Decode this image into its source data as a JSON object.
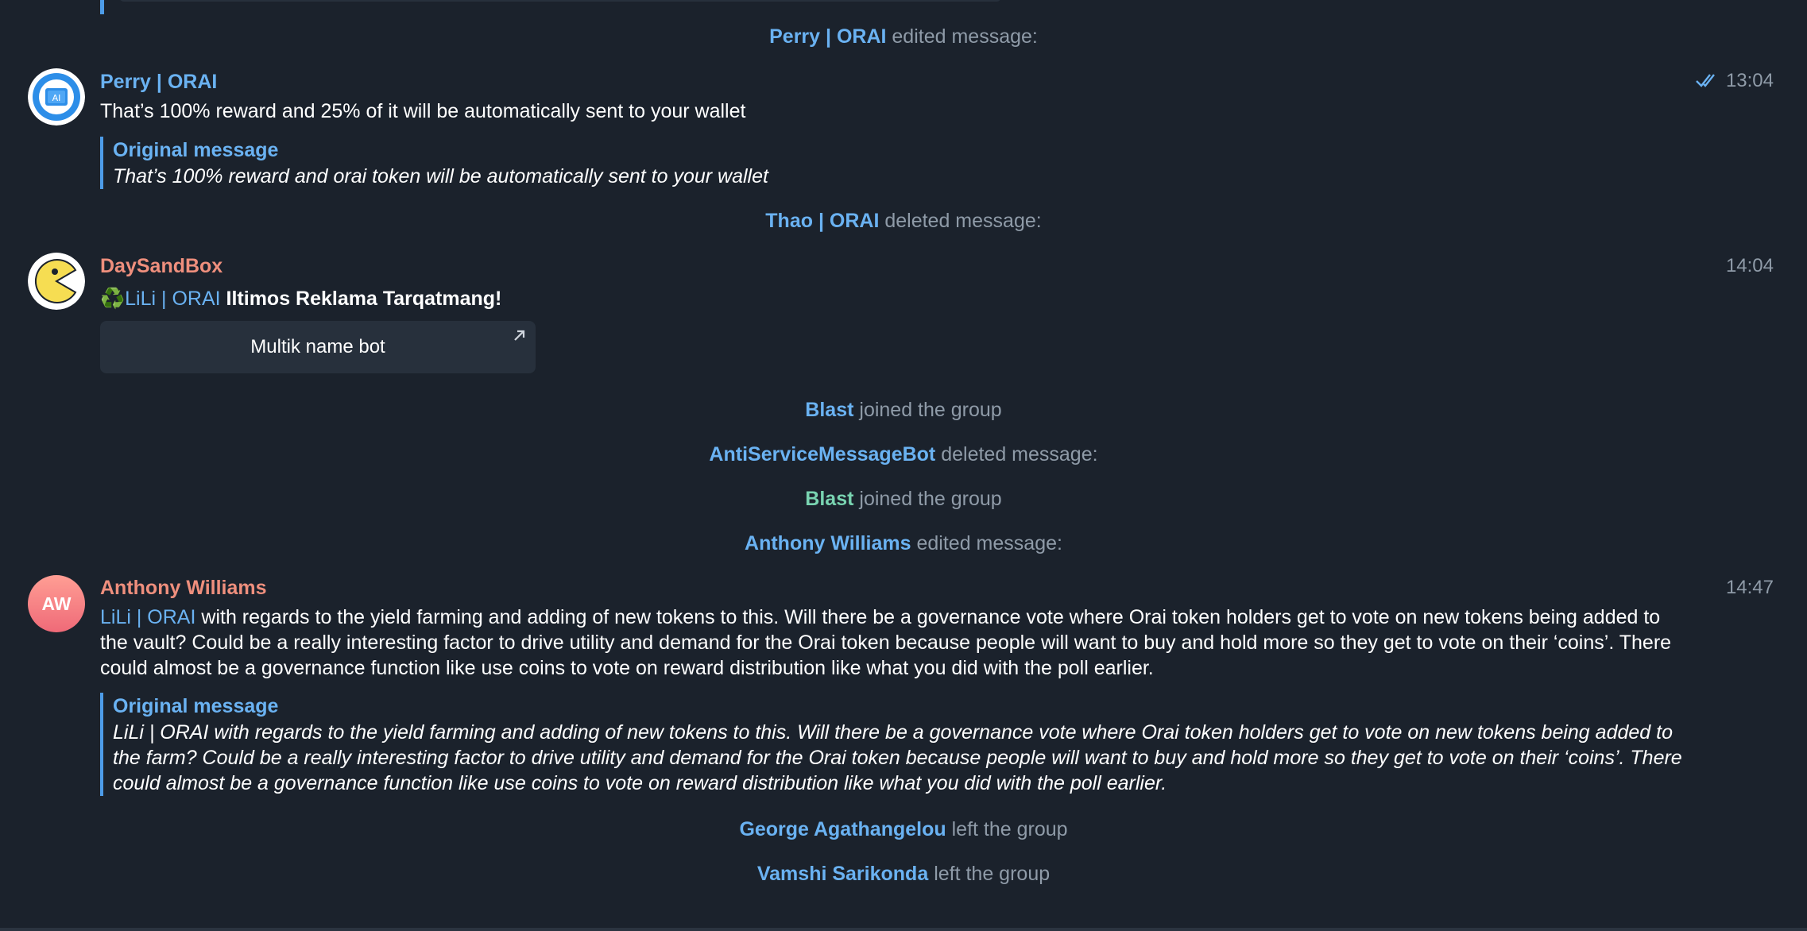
{
  "colors": {
    "background": "#1b222c",
    "accent_blue": "#6ab2f2",
    "accent_green": "#79d4b1",
    "sender_salmon": "#ef8f7d",
    "muted_text": "#8f9ba8"
  },
  "service_messages": [
    {
      "who": "Perry | ORAI",
      "action": "edited message:"
    },
    {
      "who": "Thao | ORAI",
      "action": "deleted message:"
    },
    {
      "who": "Blast",
      "action": "joined the group"
    },
    {
      "who": "AntiServiceMessageBot",
      "action": "deleted message:"
    },
    {
      "who": "Blast",
      "action": "joined the group"
    },
    {
      "who": "Anthony Williams",
      "action": "edited message:"
    },
    {
      "who": "George Agathangelou",
      "action": "left the group"
    },
    {
      "who": "Vamshi Sarikonda",
      "action": "left the group"
    }
  ],
  "messages": {
    "perry": {
      "avatar_icon": "orai-logo-icon",
      "avatar_text": "AI",
      "sender": "Perry | ORAI",
      "time": "13:04",
      "status_icon": "double-check-icon",
      "text": "That’s 100% reward and 25% of it will be automatically sent to your wallet",
      "quote_title": "Original message",
      "quote_text": "That’s 100% reward and orai token will be automatically sent to your wallet"
    },
    "daysandbox": {
      "avatar_icon": "pacman-icon",
      "sender": "DaySandBox",
      "time": "14:04",
      "emoji": "♻️",
      "mention": "LiLi | ORAI",
      "bold_text": "Iltimos Reklama Tarqatmang!",
      "button_label": "Multik name bot",
      "button_icon": "external-arrow-icon"
    },
    "anthony": {
      "avatar_initials": "AW",
      "sender": "Anthony Williams",
      "time": "14:47",
      "mention": "LiLi | ORAI",
      "text": " with regards to the yield farming and adding of new tokens to this. Will there be a governance vote where Orai token holders get to vote on new tokens being added to the vault? Could be a really interesting factor to drive utility and demand for the Orai token because people will want to buy and hold more so they get to vote on their ‘coins’. There could almost be a governance function like use coins to vote on reward distribution like what you did with the poll earlier.",
      "quote_title": "Original message",
      "quote_text": "LiLi | ORAI with regards to the yield farming and adding of new tokens to this. Will there be a governance vote where Orai token holders get to vote on new tokens being added to the farm? Could be a really interesting factor to drive utility and demand for the Orai token because people will want to buy and hold more so they get to vote on their ‘coins’. There could almost be a governance function like use coins to vote on reward distribution like what you did with the poll earlier."
    }
  }
}
